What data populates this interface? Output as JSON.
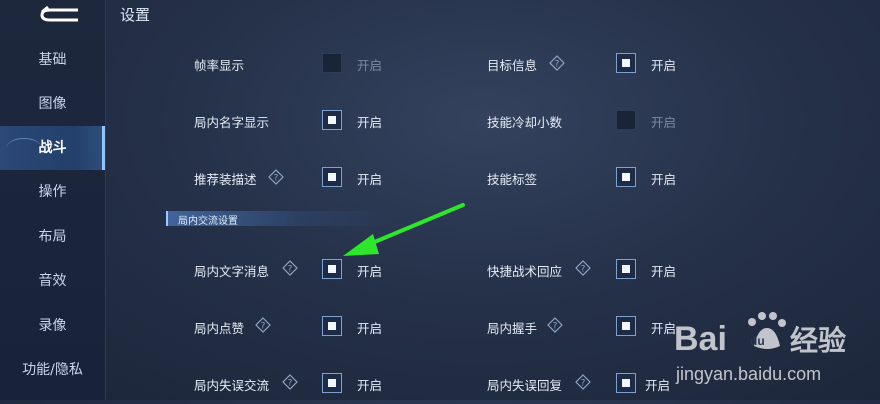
{
  "page_title": "设置",
  "sidebar": {
    "items": [
      {
        "label": "基础"
      },
      {
        "label": "图像"
      },
      {
        "label": "战斗",
        "active": true
      },
      {
        "label": "操作"
      },
      {
        "label": "布局"
      },
      {
        "label": "音效"
      },
      {
        "label": "录像"
      },
      {
        "label": "功能/隐私"
      }
    ]
  },
  "settings": {
    "frame_rate": {
      "label": "帧率显示",
      "toggle": "开启",
      "checked": false
    },
    "target_info": {
      "label": "目标信息",
      "toggle": "开启",
      "checked": true
    },
    "ingame_name": {
      "label": "局内名字显示",
      "toggle": "开启",
      "checked": true
    },
    "skill_cooldown": {
      "label": "技能冷却小数",
      "toggle": "开启",
      "checked": false
    },
    "recommend_desc": {
      "label": "推荐装描述",
      "toggle": "开启",
      "checked": true
    },
    "skill_tag": {
      "label": "技能标签",
      "toggle": "开启",
      "checked": true
    }
  },
  "section": {
    "title": "局内交流设置"
  },
  "communication": {
    "text_message": {
      "label": "局内文字消息",
      "toggle": "开启",
      "checked": true
    },
    "quick_reply": {
      "label": "快捷战术回应",
      "toggle": "开启",
      "checked": true
    },
    "like": {
      "label": "局内点赞",
      "toggle": "开启",
      "checked": true
    },
    "handshake": {
      "label": "局内握手",
      "toggle": "开启",
      "checked": true
    },
    "mistake_comm": {
      "label": "局内失误交流",
      "toggle": "开启",
      "checked": true
    },
    "mistake_reply": {
      "label": "局内失误回复",
      "toggle": "开启",
      "checked": true
    }
  },
  "watermark": {
    "brand": "Baidu 经验",
    "url": "jingyan.baidu.com"
  },
  "colors": {
    "arrow": "#2ee62b",
    "checkbox_border": "#7ea1d1",
    "active_tab": "#2c4a7a"
  }
}
